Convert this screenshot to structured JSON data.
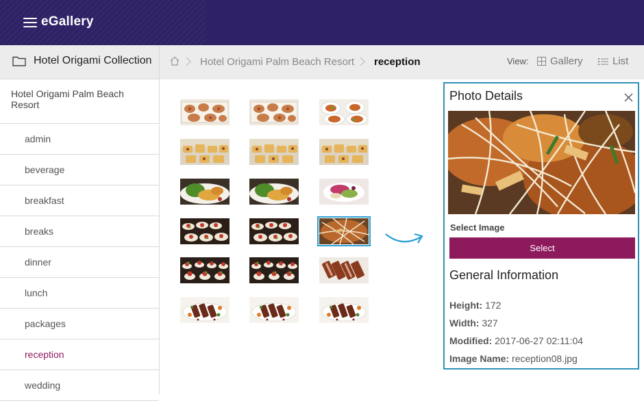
{
  "app": {
    "brand": "eGallery"
  },
  "sidebar": {
    "title": "Hotel Origami Collection",
    "root": "Hotel Origami Palm Beach Resort",
    "items": [
      {
        "label": "admin"
      },
      {
        "label": "beverage"
      },
      {
        "label": "breakfast"
      },
      {
        "label": "breaks"
      },
      {
        "label": "dinner"
      },
      {
        "label": "lunch"
      },
      {
        "label": "packages"
      },
      {
        "label": "reception",
        "active": true
      },
      {
        "label": "wedding"
      }
    ]
  },
  "breadcrumb": {
    "items": [
      "Hotel Origami Palm Beach Resort"
    ],
    "current": "reception"
  },
  "view": {
    "label": "View:",
    "gallery": "Gallery",
    "list": "List"
  },
  "gallery": {
    "selected_index": 9,
    "thumbs": [
      "platter-icon",
      "platter-icon",
      "plates-icon",
      "tray-icon",
      "tray-icon",
      "tray-icon",
      "greens-icon",
      "greens-icon",
      "salad-icon",
      "spoons-icon",
      "spoons-icon",
      "noodles-icon",
      "canape-icon",
      "canape-icon",
      "roast-icon",
      "steak-icon",
      "steak-icon",
      "steak-icon"
    ]
  },
  "details": {
    "title": "Photo Details",
    "select_label": "Select Image",
    "select_button": "Select",
    "general_title": "General Information",
    "height_label": "Height:",
    "height": "172",
    "width_label": "Width:",
    "width": "327",
    "modified_label": "Modified:",
    "modified": "2017-06-27 02:11:04",
    "name_label": "Image Name:",
    "name": "reception08.jpg"
  },
  "colors": {
    "header": "#2e2166",
    "accent": "#8e1a5e",
    "selection": "#2aa0d6"
  }
}
